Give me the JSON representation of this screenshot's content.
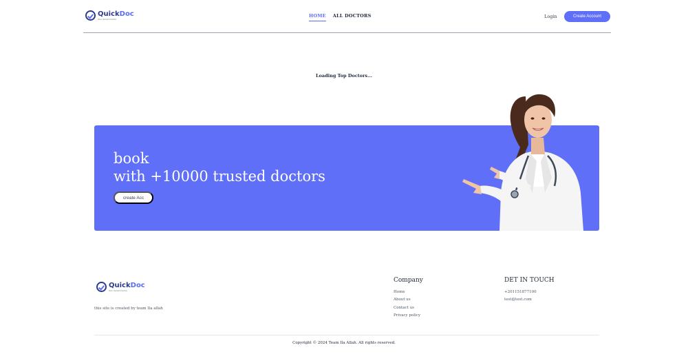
{
  "brand": {
    "name_part1": "Quick",
    "name_part2": "Doc",
    "tagline": "Your Smart Doctor"
  },
  "nav": {
    "items": [
      {
        "label": "HOME"
      },
      {
        "label": "ALL DOCTORS"
      }
    ]
  },
  "header": {
    "login_label": "Login",
    "create_account_label": "Create Account"
  },
  "main": {
    "loading_text": "Loading Top Doctors..."
  },
  "banner": {
    "line1": "book",
    "line2": "with +10000 trusted doctors",
    "button_label": "create Acc"
  },
  "footer": {
    "note": "this site is created by team Ila allah",
    "company": {
      "title": "Company",
      "links": [
        "Home",
        "About us",
        "Contact us",
        "Privacy policy"
      ]
    },
    "contact": {
      "title": "DET IN TOUCH",
      "phone": "+201151877100",
      "email": "test@test.com"
    },
    "copyright": "Copyright © 2024 Team Ila Allah. All rights reserved."
  },
  "colors": {
    "accent": "#5f6ff7",
    "brand_dark": "#2b3a8f"
  }
}
